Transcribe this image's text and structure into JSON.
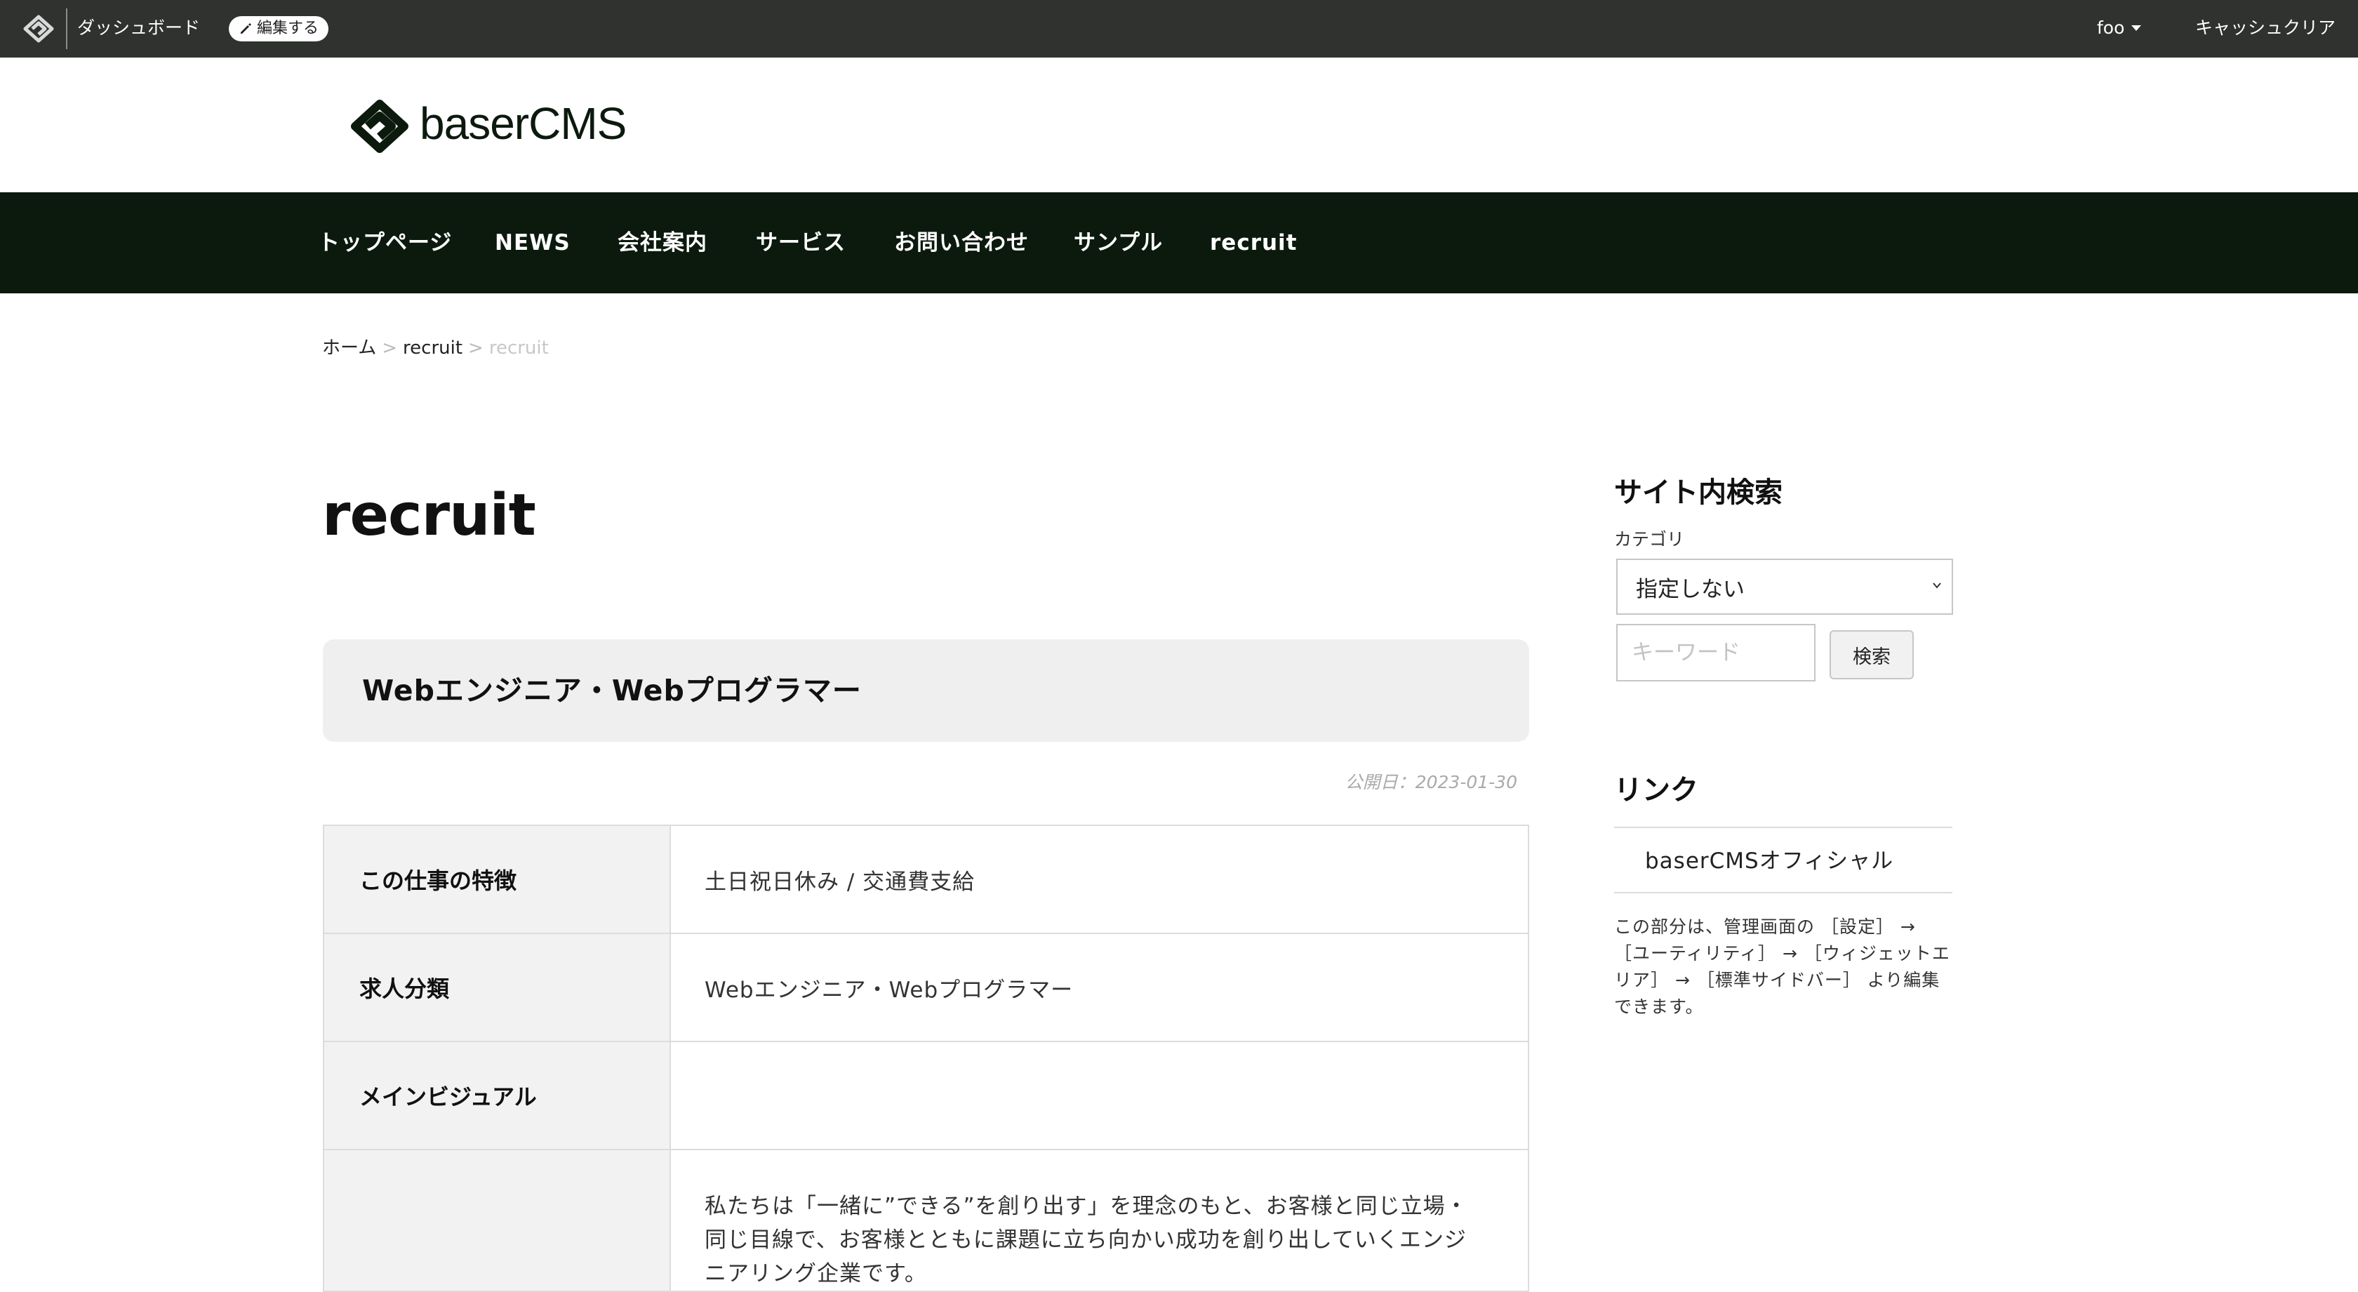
{
  "admin_bar": {
    "dashboard_label": "ダッシュボード",
    "edit_label": "編集する",
    "user_label": "foo",
    "cache_clear_label": "キャッシュクリア"
  },
  "header": {
    "logo_text": "baserCMS"
  },
  "nav": {
    "items": [
      {
        "label": "トップページ"
      },
      {
        "label": "NEWS"
      },
      {
        "label": "会社案内"
      },
      {
        "label": "サービス"
      },
      {
        "label": "お問い合わせ"
      },
      {
        "label": "サンプル"
      },
      {
        "label": "recruit"
      }
    ]
  },
  "breadcrumb": {
    "home": "ホーム",
    "separator": ">",
    "parent": "recruit",
    "current": "recruit"
  },
  "main": {
    "page_title": "recruit",
    "job_title": "Webエンジニア・Webプログラマー",
    "publish_date": "公開日：2023-01-30",
    "rows": [
      {
        "label": "この仕事の特徴",
        "value": "土日祝日休み / 交通費支給"
      },
      {
        "label": "求人分類",
        "value": "Webエンジニア・Webプログラマー"
      },
      {
        "label": "メインビジュアル",
        "value": ""
      },
      {
        "label": "",
        "value": "私たちは「一緒に”できる”を創り出す」を理念のもと、お客様と同じ立場・同じ目線で、お客様とともに課題に立ち向かい成功を創り出していくエンジニアリング企業です。"
      }
    ]
  },
  "sidebar": {
    "search": {
      "title": "サイト内検索",
      "category_label": "カテゴリ",
      "category_value": "指定しない",
      "keyword_placeholder": "キーワード",
      "button_label": "検索"
    },
    "links": {
      "title": "リンク",
      "items": [
        {
          "label": "baserCMSオフィシャル"
        }
      ]
    },
    "note": "この部分は、管理画面の ［設定］ → ［ユーティリティ］ → ［ウィジェットエリア］ → ［標準サイドバー］ より編集できます。"
  },
  "colors": {
    "admin_bar": "#2f322f",
    "nav_background": "#0c1a0e",
    "heading_box": "#efefef"
  }
}
